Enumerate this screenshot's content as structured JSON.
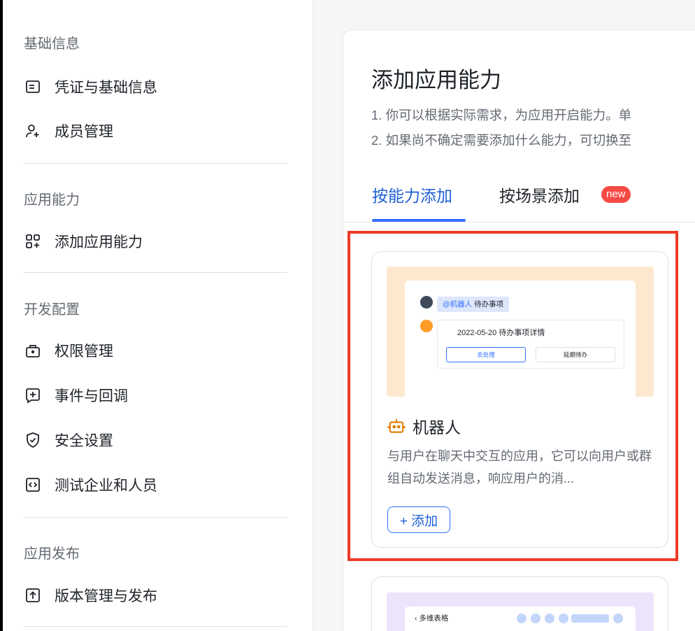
{
  "sidebar": {
    "sections": [
      {
        "title": "基础信息",
        "items": [
          {
            "label": "凭证与基础信息",
            "icon": "credential-icon"
          },
          {
            "label": "成员管理",
            "icon": "add-member-icon"
          }
        ]
      },
      {
        "title": "应用能力",
        "items": [
          {
            "label": "添加应用能力",
            "icon": "add-apps-icon"
          }
        ]
      },
      {
        "title": "开发配置",
        "items": [
          {
            "label": "权限管理",
            "icon": "permission-icon"
          },
          {
            "label": "事件与回调",
            "icon": "event-icon"
          },
          {
            "label": "安全设置",
            "icon": "shield-icon"
          },
          {
            "label": "测试企业和人员",
            "icon": "code-icon"
          }
        ]
      },
      {
        "title": "应用发布",
        "items": [
          {
            "label": "版本管理与发布",
            "icon": "upload-icon"
          }
        ]
      }
    ]
  },
  "main": {
    "title": "添加应用能力",
    "desc1": "1. 你可以根据实际需求，为应用开启能力。单",
    "desc2": "2. 如果尚不确定需要添加什么能力，可切换至",
    "tabs": [
      {
        "label": "按能力添加",
        "active": true
      },
      {
        "label": "按场景添加",
        "active": false
      }
    ],
    "new_badge": "new",
    "feature": {
      "name": "机器人",
      "description": "与用户在聊天中交互的应用，它可以向用户或群组自动发送消息，响应用户的消...",
      "add_label": "+ 添加",
      "preview": {
        "at_label": "@机器人",
        "todo_label": "待办事项",
        "msg_title": "2022-05-20 待办事项详情",
        "btn_process": "去处理",
        "btn_delay": "延期待办"
      }
    },
    "feature2": {
      "preview_title": "多维表格"
    }
  },
  "colors": {
    "accent": "#3370ff",
    "highlight": "#f03b26",
    "badge": "#f54a45",
    "preview_bg": "#fde8cf"
  }
}
